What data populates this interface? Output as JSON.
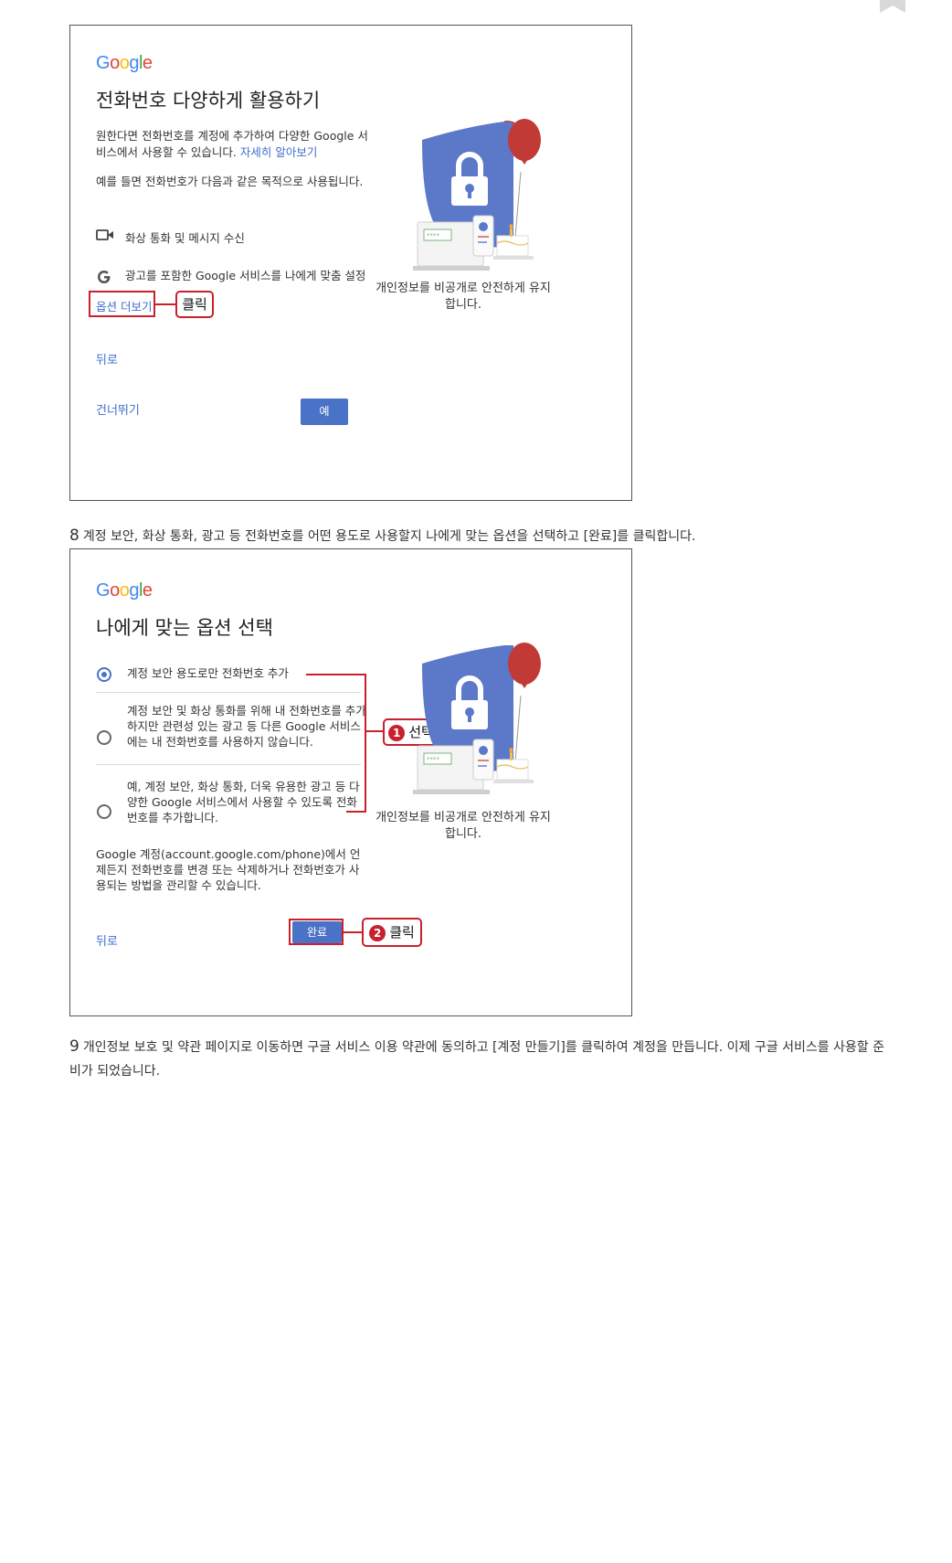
{
  "screen1": {
    "logo": [
      "G",
      "o",
      "o",
      "g",
      "l",
      "e"
    ],
    "title": "전화번호 다양하게 활용하기",
    "intro": "원한다면 전화번호를 계정에 추가하여 다양한 Google 서비스에서 사용할 수 있습니다.",
    "learn_more": "자세히 알아보기",
    "example": "예를 들면 전화번호가 다음과 같은 목적으로 사용됩니다.",
    "feature_video": "화상 통화 및 메시지 수신",
    "feature_ads": "광고를 포함한 Google 서비스를 나에게 맞춤 설정",
    "more_options": "옵션 더보기",
    "callout_click": "클릭",
    "back": "뒤로",
    "skip": "건너뛰기",
    "yes": "예",
    "caption": "개인정보를 비공개로 안전하게 유지합니다."
  },
  "step8": {
    "number": "8",
    "text": "계정 보안, 화상 통화, 광고 등 전화번호를 어떤 용도로 사용할지 나에게 맞는 옵션을 선택하고 [완료]를 클릭합니다."
  },
  "screen2": {
    "logo": [
      "G",
      "o",
      "o",
      "g",
      "l",
      "e"
    ],
    "title": "나에게 맞는 옵션 선택",
    "option1": "계정 보안 용도로만 전화번호 추가",
    "option2": "계정 보안 및 화상 통화를 위해 내 전화번호를 추가하지만 관련성 있는 광고 등 다른 Google 서비스에는 내 전화번호를 사용하지 않습니다.",
    "option3": "예, 계정 보안, 화상 통화, 더욱 유용한 광고 등 다양한 Google 서비스에서 사용할 수 있도록 전화번호를 추가합니다.",
    "selected_option": 1,
    "footer_note": "Google 계정(account.google.com/phone)에서 언제든지 전화번호를 변경 또는 삭제하거나 전화번호가 사용되는 방법을 관리할 수 있습니다.",
    "back": "뒤로",
    "done": "완료",
    "callout1_num": "1",
    "callout1": "선택",
    "callout2_num": "2",
    "callout2": "클릭",
    "caption": "개인정보를 비공개로 안전하게 유지합니다."
  },
  "step9": {
    "number": "9",
    "text": "개인정보 보호 및 약관 페이지로 이동하면 구글 서비스 이용 약관에 동의하고 [계정 만들기]를 클릭하여 계정을 만듭니다. 이제 구글 서비스를 사용할 준비가 되었습니다."
  },
  "icons": {
    "bookmark": "bookmark-icon",
    "video": "video-camera-icon",
    "google_g": "google-g-icon",
    "illustration": "security-shield-lock-illustration"
  },
  "colors": {
    "google_blue": "#4285F4",
    "button_blue": "#4a72c7",
    "callout_red": "#c8202d",
    "link_blue": "#3f6ecf"
  }
}
